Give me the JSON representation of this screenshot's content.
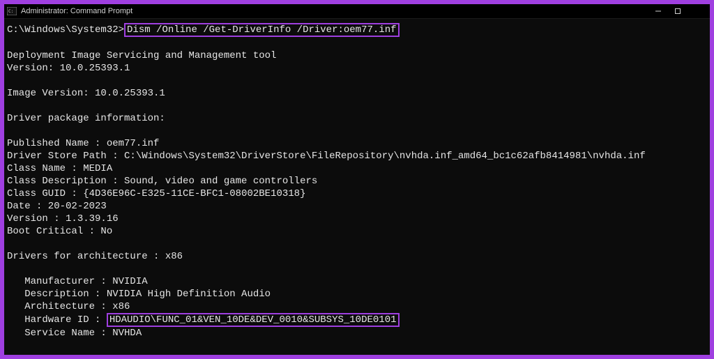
{
  "window": {
    "title": "Administrator: Command Prompt"
  },
  "cmd": {
    "prompt": "C:\\Windows\\System32>",
    "command": "Dism /Online /Get-DriverInfo /Driver:oem77.inf"
  },
  "dism": {
    "header": "Deployment Image Servicing and Management tool",
    "version_line": "Version: 10.0.25393.1",
    "image_version_line": "Image Version: 10.0.25393.1",
    "pkg_header": "Driver package information:",
    "published_name": "Published Name : oem77.inf",
    "driver_store_path": "Driver Store Path : C:\\Windows\\System32\\DriverStore\\FileRepository\\nvhda.inf_amd64_bc1c62afb8414981\\nvhda.inf",
    "class_name": "Class Name : MEDIA",
    "class_description": "Class Description : Sound, video and game controllers",
    "class_guid": "Class GUID : {4D36E96C-E325-11CE-BFC1-08002BE10318}",
    "date": "Date : 20-02-2023",
    "version": "Version : 1.3.39.16",
    "boot_critical": "Boot Critical : No",
    "arch_header": "Drivers for architecture : x86",
    "manufacturer": "   Manufacturer : NVIDIA",
    "description": "   Description : NVIDIA High Definition Audio",
    "architecture": "   Architecture : x86",
    "hardware_id_label": "   Hardware ID : ",
    "hardware_id_value": "HDAUDIO\\FUNC_01&VEN_10DE&DEV_0010&SUBSYS_10DE0101",
    "service_name": "   Service Name : NVHDA"
  }
}
